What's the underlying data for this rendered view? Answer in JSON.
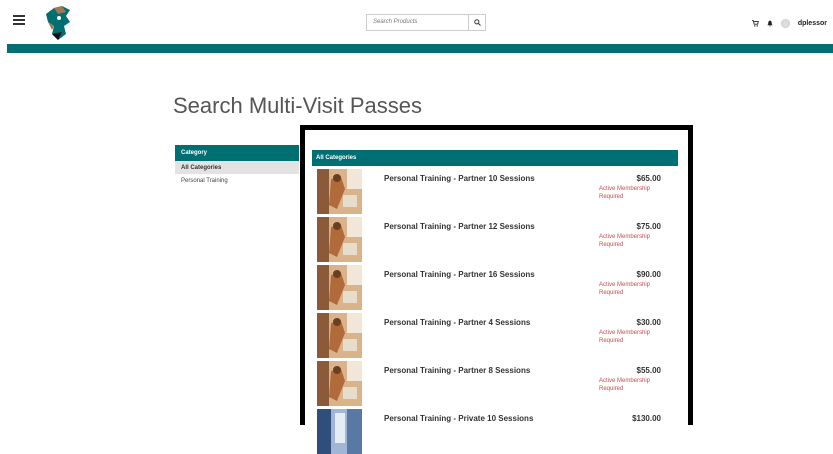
{
  "header": {
    "search_placeholder": "Search Products",
    "username": "dplessor"
  },
  "page": {
    "title": "Search Multi-Visit Passes"
  },
  "categories": {
    "heading": "Category",
    "items": [
      "All Categories",
      "Personal Training"
    ]
  },
  "products": {
    "heading": "All Categories",
    "items": [
      {
        "name": "Personal Training - Partner 10 Sessions",
        "price": "$65.00",
        "note": "Active Membership Required"
      },
      {
        "name": "Personal Training - Partner 12 Sessions",
        "price": "$75.00",
        "note": "Active Membership Required"
      },
      {
        "name": "Personal Training - Partner 16 Sessions",
        "price": "$90.00",
        "note": "Active Membership Required"
      },
      {
        "name": "Personal Training - Partner 4 Sessions",
        "price": "$30.00",
        "note": "Active Membership Required"
      },
      {
        "name": "Personal Training - Partner 8 Sessions",
        "price": "$55.00",
        "note": "Active Membership Required"
      },
      {
        "name": "Personal Training - Private 10 Sessions",
        "price": "$130.00",
        "note": ""
      }
    ]
  },
  "colors": {
    "teal": "#006f71",
    "alert": "#c0504d"
  }
}
